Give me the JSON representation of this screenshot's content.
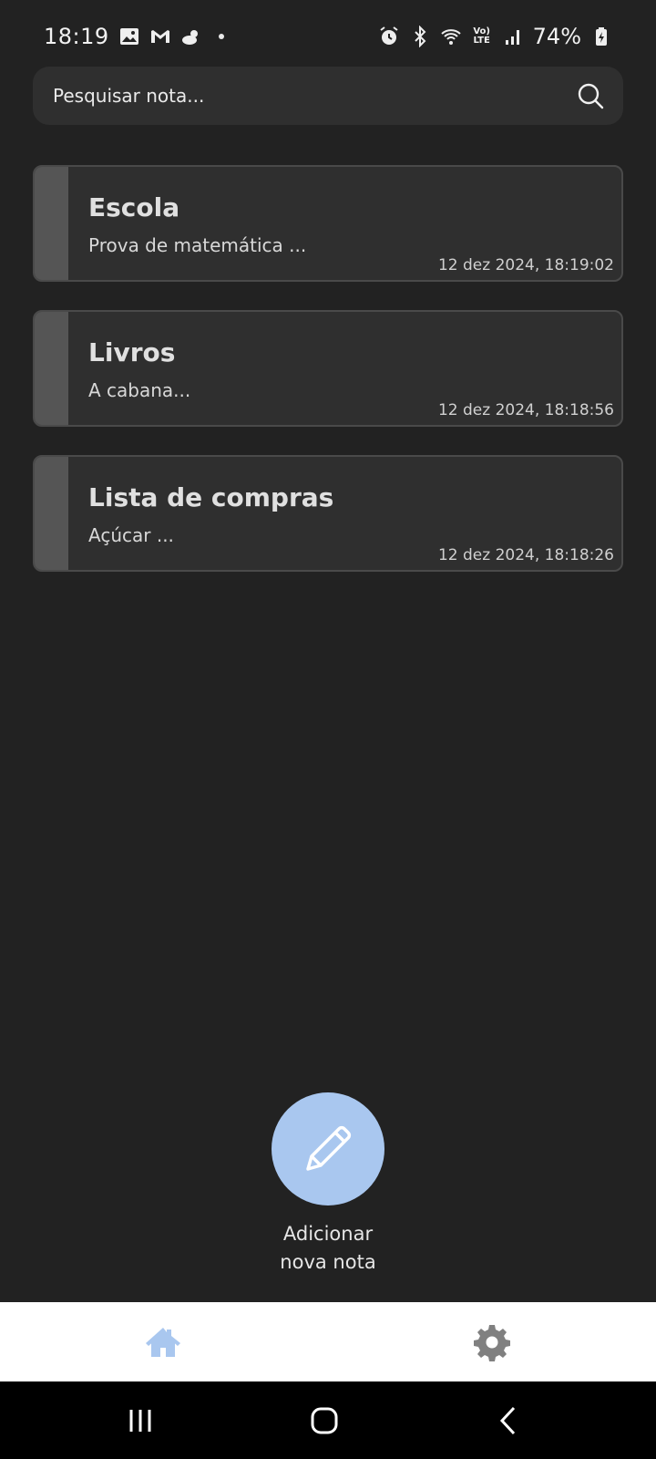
{
  "status_bar": {
    "time": "18:19",
    "battery": "74%",
    "left_icons": [
      "gallery-icon",
      "gmail-icon",
      "weather-icon"
    ],
    "right_icons": [
      "alarm-icon",
      "bluetooth-icon",
      "wifi-icon",
      "volte-icon",
      "signal-icon",
      "battery-icon"
    ],
    "volte_top": "Vo)",
    "volte_bottom": "LTE"
  },
  "search": {
    "placeholder": "Pesquisar nota..."
  },
  "notes": [
    {
      "title": "Escola",
      "preview": "Prova de matemática ...",
      "date": "12 dez 2024, 18:19:02"
    },
    {
      "title": "Livros",
      "preview": "A cabana...",
      "date": "12 dez 2024, 18:18:56"
    },
    {
      "title": "Lista de compras",
      "preview": "Açúcar ...",
      "date": "12 dez 2024, 18:18:26"
    }
  ],
  "fab": {
    "label_line1": "Adicionar",
    "label_line2": "nova nota",
    "icon": "pencil-icon",
    "color": "#a9c7ef"
  },
  "bottom_nav": {
    "items": [
      {
        "icon": "home-icon",
        "active": true,
        "color": "#a9c7ef"
      },
      {
        "icon": "gear-icon",
        "active": false,
        "color": "#808080"
      }
    ]
  },
  "colors": {
    "background": "#222222",
    "card": "#2f2f2f",
    "stripe": "#555555",
    "accent": "#a9c7ef"
  }
}
